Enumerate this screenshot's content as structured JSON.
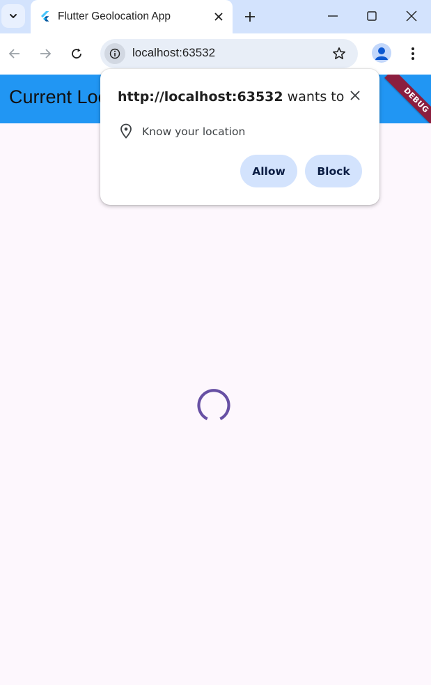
{
  "browser": {
    "tab_title": "Flutter Geolocation App",
    "url": "localhost:63532"
  },
  "app": {
    "title": "Current Location",
    "debug_banner": "DEBUG"
  },
  "permission_popup": {
    "origin": "http://localhost:63532",
    "suffix": " wants to",
    "permission_label": "Know your location",
    "allow_label": "Allow",
    "block_label": "Block"
  },
  "colors": {
    "tabstrip": "#d3e3fd",
    "appbar": "#2196f3",
    "spinner": "#6750a4",
    "background": "#fdf7fd",
    "debug_banner": "#8b1e3f"
  },
  "icons": {
    "tab_search": "chevron-down-icon",
    "favicon": "flutter-logo-icon",
    "tab_close": "close-icon",
    "new_tab": "plus-icon",
    "back": "arrow-left-icon",
    "forward": "arrow-right-icon",
    "reload": "reload-icon",
    "site_info": "info-icon",
    "bookmark": "star-icon",
    "profile": "profile-icon",
    "menu": "more-vert-icon",
    "location": "location-pin-icon"
  }
}
